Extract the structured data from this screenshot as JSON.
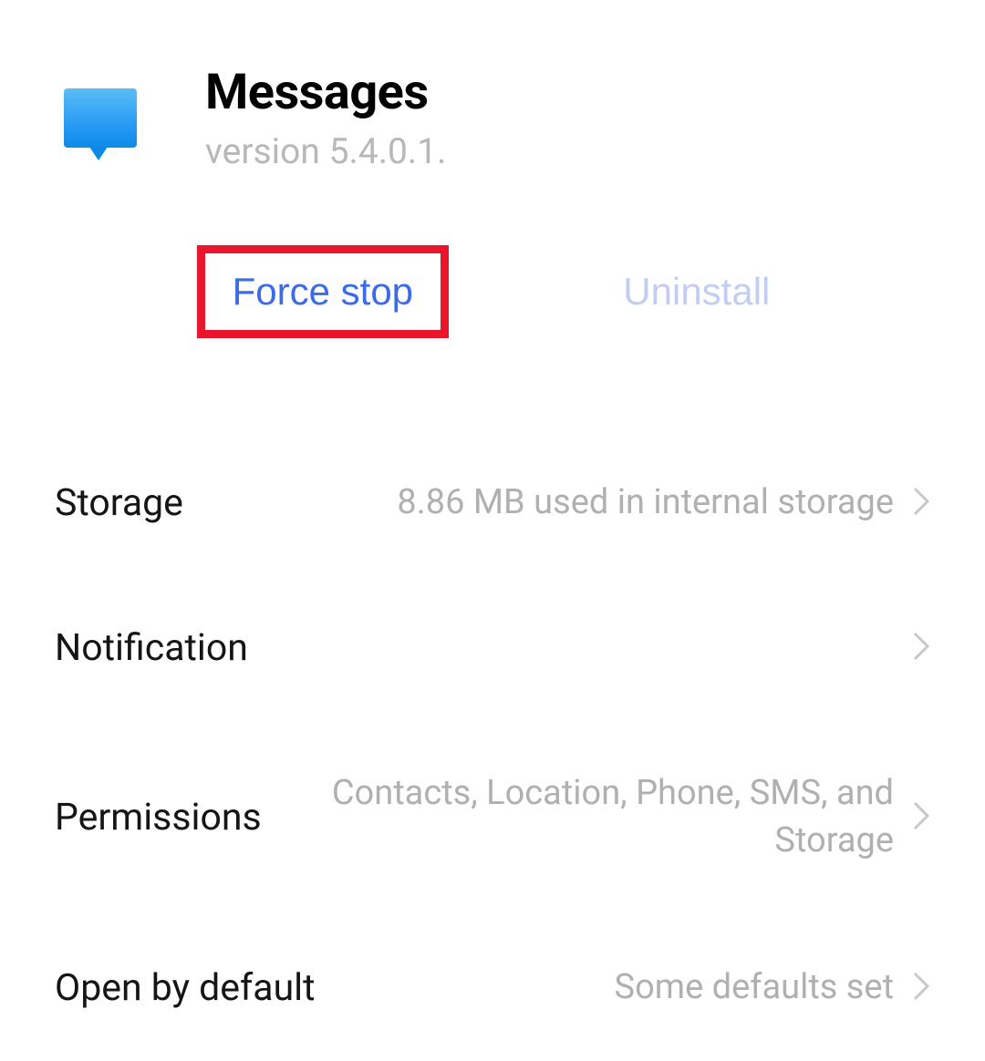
{
  "header": {
    "app_name": "Messages",
    "version_label": "version 5.4.0.1."
  },
  "actions": {
    "force_stop": "Force stop",
    "uninstall": "Uninstall"
  },
  "list": {
    "storage": {
      "label": "Storage",
      "value": "8.86 MB used in internal storage"
    },
    "notification": {
      "label": "Notification"
    },
    "permissions": {
      "label": "Permissions",
      "value": "Contacts, Location, Phone, SMS, and Storage"
    },
    "open_by_default": {
      "label": "Open by default",
      "value": "Some defaults set"
    }
  },
  "colors": {
    "highlight_border": "#e8152b",
    "primary_action": "#3a6be8",
    "disabled_action": "#c2cdf4"
  }
}
